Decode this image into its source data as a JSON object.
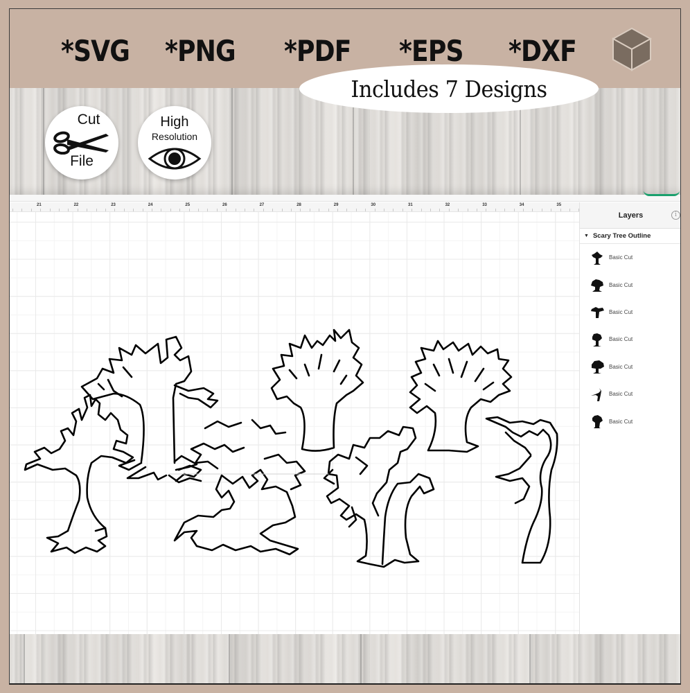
{
  "banner": {
    "formats": [
      "*SVG",
      "*PNG",
      "*PDF",
      "*EPS",
      "*DXF"
    ],
    "tagline": "Includes 7 Designs",
    "logo_icon": "box-cube-icon"
  },
  "badges": {
    "cut_file": {
      "line1": "Cut",
      "line2": "File",
      "icon": "scissors-icon"
    },
    "high_res": {
      "line1": "High",
      "line2": "Resolution",
      "icon": "eye-icon"
    }
  },
  "ruler": {
    "labels": [
      "21",
      "22",
      "23",
      "24",
      "25",
      "26",
      "27",
      "28",
      "29",
      "30",
      "31",
      "32",
      "33",
      "34",
      "35"
    ]
  },
  "layers_panel": {
    "title": "Layers",
    "info_icon": "info-icon",
    "group": {
      "name": "Scary Tree Outline",
      "expanded": true
    },
    "items": [
      {
        "label": "Basic Cut",
        "icon": "tree-thumbnail-icon"
      },
      {
        "label": "Basic Cut",
        "icon": "tree-thumbnail-icon"
      },
      {
        "label": "Basic Cut",
        "icon": "tree-thumbnail-icon"
      },
      {
        "label": "Basic Cut",
        "icon": "tree-thumbnail-icon"
      },
      {
        "label": "Basic Cut",
        "icon": "tree-thumbnail-icon"
      },
      {
        "label": "Basic Cut",
        "icon": "tree-thumbnail-icon"
      },
      {
        "label": "Basic Cut",
        "icon": "tree-thumbnail-icon"
      }
    ]
  },
  "canvas": {
    "design_count": 7,
    "design_name": "Scary Tree Outline"
  },
  "colors": {
    "frame_bg": "#c8b2a3",
    "accent_green": "#1aa06d",
    "stroke": "#000000"
  }
}
